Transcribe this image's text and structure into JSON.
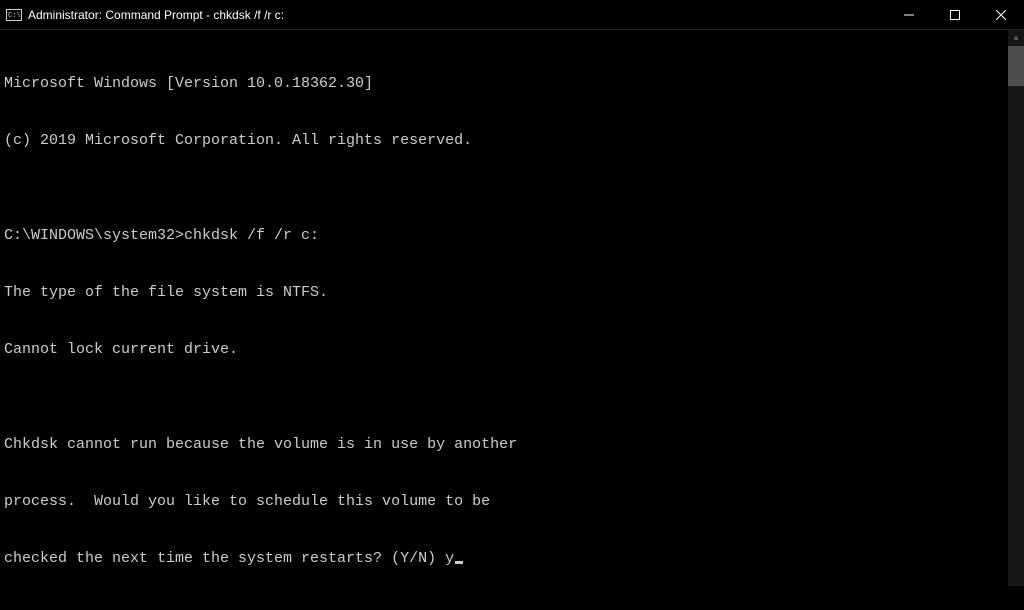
{
  "window": {
    "title": "Administrator: Command Prompt - chkdsk  /f /r c:"
  },
  "terminal": {
    "lines": [
      "Microsoft Windows [Version 10.0.18362.30]",
      "(c) 2019 Microsoft Corporation. All rights reserved.",
      "",
      "C:\\WINDOWS\\system32>chkdsk /f /r c:",
      "The type of the file system is NTFS.",
      "Cannot lock current drive.",
      "",
      "Chkdsk cannot run because the volume is in use by another",
      "process.  Would you like to schedule this volume to be",
      "checked the next time the system restarts? (Y/N) y"
    ]
  }
}
